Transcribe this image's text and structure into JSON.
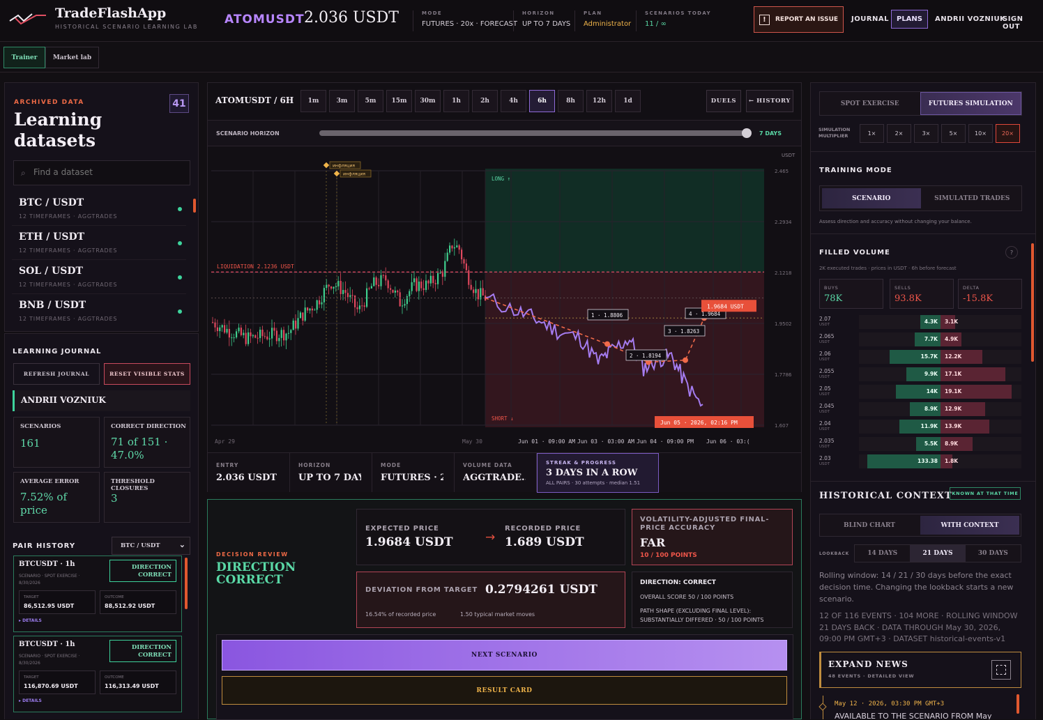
{
  "header": {
    "app_name": "TradeFlashApp",
    "app_subtitle": "HISTORICAL SCENARIO LEARNING LAB",
    "symbol": "ATOMUSDT",
    "price": "2.036 USDT",
    "metrics": [
      {
        "key": "MODE",
        "value": "FUTURES · 20x · FORECAST"
      },
      {
        "key": "HORIZON",
        "value": "UP TO 7 DAYS"
      },
      {
        "key": "PLAN",
        "value": "Administrator"
      },
      {
        "key": "SCENARIOS TODAY",
        "value": "11 / ∞"
      }
    ],
    "report_label": "REPORT AN ISSUE",
    "nav": {
      "journal": "JOURNAL",
      "plans": "PLANS",
      "user": "ANDRII VOZNIUK",
      "signout": "SIGN OUT"
    }
  },
  "subtabs": {
    "trainer": "Trainer",
    "market_lab": "Market lab"
  },
  "datasets": {
    "kicker": "ARCHIVED DATA",
    "title_line1": "Learning",
    "title_line2": "datasets",
    "count": "41",
    "search_placeholder": "Find a dataset",
    "items": [
      {
        "name": "BTC / USDT",
        "sub": "12 TIMEFRAMES · AGGTRADES"
      },
      {
        "name": "ETH / USDT",
        "sub": "12 TIMEFRAMES · AGGTRADES"
      },
      {
        "name": "SOL / USDT",
        "sub": "12 TIMEFRAMES · AGGTRADES"
      },
      {
        "name": "BNB / USDT",
        "sub": "12 TIMEFRAMES · AGGTRADES"
      }
    ]
  },
  "journal": {
    "title": "LEARNING JOURNAL",
    "refresh": "REFRESH JOURNAL",
    "reset": "RESET VISIBLE STATS",
    "user": "ANDRII VOZNIUK",
    "stats": [
      {
        "key": "SCENARIOS",
        "value": "161"
      },
      {
        "key": "CORRECT DIRECTION",
        "value": "71 of 151 · 47.0%"
      },
      {
        "key": "AVERAGE ERROR",
        "value": "7.52% of price"
      },
      {
        "key": "THRESHOLD CLOSURES",
        "value": "3"
      }
    ]
  },
  "pair_history": {
    "title": "PAIR HISTORY",
    "select": "BTC / USDT",
    "items": [
      {
        "title": "BTCUSDT · 1h",
        "sub": "SCENARIO · SPOT EXERCISE · 8/30/2026",
        "badge": "DIRECTION CORRECT",
        "target_label": "TARGET",
        "target": "86,512.95 USDT",
        "outcome_label": "OUTCOME",
        "outcome": "88,512.92 USDT",
        "details": "▸ DETAILS"
      },
      {
        "title": "BTCUSDT · 1h",
        "sub": "SCENARIO · SPOT EXERCISE · 8/30/2026",
        "badge": "DIRECTION CORRECT",
        "target_label": "TARGET",
        "target": "116,870.69 USDT",
        "outcome_label": "OUTCOME",
        "outcome": "116,313.49 USDT",
        "details": "▸ DETAILS"
      }
    ]
  },
  "chart_panel": {
    "title": "ATOMUSDT / 6H",
    "timeframes": [
      "1m",
      "3m",
      "5m",
      "15m",
      "30m",
      "1h",
      "2h",
      "4h",
      "6h",
      "8h",
      "12h",
      "1d"
    ],
    "active_tf": "6h",
    "duels": "DUELS",
    "history": "← HISTORY",
    "horizon_label": "SCENARIO HORIZON",
    "horizon_value": "7 DAYS",
    "info": [
      {
        "key": "ENTRY",
        "value": "2.036 USDT"
      },
      {
        "key": "HORIZON",
        "value": "UP TO 7 DAYS"
      },
      {
        "key": "MODE",
        "value": "FUTURES · 2..."
      },
      {
        "key": "VOLUME DATA",
        "value": "AGGTRADE..."
      }
    ],
    "streak": {
      "key": "STREAK & PROGRESS",
      "value": "3 DAYS IN A ROW",
      "sub": "ALL PAIRS · 30 attempts · median 1.51"
    }
  },
  "chart_data": {
    "type": "candlestick",
    "unit_label": "USDT",
    "y_ticks": [
      "2.465",
      "2.2934",
      "2.1218",
      "1.9502",
      "1.7786",
      "1.607"
    ],
    "ylim": [
      1.607,
      2.465
    ],
    "x_ticks": [
      "Apr 29",
      "May 30",
      "Jun 01 · 09:00 AM",
      "Jun 03 · 03:00 AM",
      "Jun 04 · 09:00 PM",
      "Jun 06 · 03:("
    ],
    "liquidation_label": "LIQUIDATION 2.1236 USDT",
    "liquidation": 2.1236,
    "long_label": "LONG ↑",
    "short_label": "SHORT ↓",
    "event_markers": [
      "инфляция",
      "инфляция"
    ],
    "forecast_points": [
      {
        "label": "1 · 1.8806",
        "value": 1.8806
      },
      {
        "label": "2 · 1.8194",
        "value": 1.8194
      },
      {
        "label": "3 · 1.8263",
        "value": 1.8263
      },
      {
        "label": "4 · 1.9684",
        "value": 1.9684
      }
    ],
    "target_label": "1.9684 USDT",
    "target_value": 1.9684,
    "end_label": "Jun 05 · 2026, 02:16 PM"
  },
  "decision": {
    "kicker": "DECISION REVIEW",
    "title_line1": "DIRECTION",
    "title_line2": "CORRECT",
    "expected_label": "EXPECTED PRICE",
    "expected": "1.9684 USDT",
    "recorded_label": "RECORDED PRICE",
    "recorded": "1.689 USDT",
    "vol_label": "VOLATILITY-ADJUSTED FINAL-PRICE ACCURACY",
    "vol_value": "FAR",
    "vol_points": "10 / 100 POINTS",
    "deviation_label": "DEVIATION FROM TARGET",
    "deviation": "0.2794261 USDT",
    "deviation_pct": "16.54% of recorded price",
    "deviation_moves": "1.50 typical market moves",
    "summary_title": "DIRECTION: CORRECT",
    "summary_line1": "OVERALL SCORE 50 / 100 POINTS",
    "summary_line2": "PATH SHAPE (EXCLUDING FINAL LEVEL): SUBSTANTIALLY DIFFERED · 50 / 100 POINTS",
    "next": "NEXT SCENARIO",
    "result": "RESULT CARD"
  },
  "right": {
    "mode_tabs": [
      "SPOT EXERCISE",
      "FUTURES SIMULATION"
    ],
    "sim_label": "SIMULATION MULTIPLIER",
    "multipliers": [
      "1×",
      "2×",
      "3×",
      "5×",
      "10×",
      "20×"
    ],
    "training_title": "TRAINING MODE",
    "training_tabs": [
      "SCENARIO",
      "SIMULATED TRADES"
    ],
    "training_note": "Assess direction and accuracy without changing your balance.",
    "filled_title": "FILLED VOLUME",
    "filled_sub": "2K executed trades · prices in USDT · 6h before forecast",
    "buys_label": "BUYS",
    "buys": "78K",
    "sells_label": "SELLS",
    "sells": "93.8K",
    "delta_label": "DELTA",
    "delta": "-15.8K",
    "orderbook": [
      {
        "price": "2.07",
        "buy": "4.3K",
        "sell": "3.1K",
        "bf": 0.25,
        "sf": 0.18
      },
      {
        "price": "2.065",
        "buy": "7.7K",
        "sell": "4.9K",
        "bf": 0.32,
        "sf": 0.26
      },
      {
        "price": "2.06",
        "buy": "15.7K",
        "sell": "12.2K",
        "bf": 0.62,
        "sf": 0.52
      },
      {
        "price": "2.055",
        "buy": "9.9K",
        "sell": "17.1K",
        "bf": 0.42,
        "sf": 0.8
      },
      {
        "price": "2.05",
        "buy": "14K",
        "sell": "19.1K",
        "bf": 0.55,
        "sf": 0.88
      },
      {
        "price": "2.045",
        "buy": "8.9K",
        "sell": "12.9K",
        "bf": 0.38,
        "sf": 0.55
      },
      {
        "price": "2.04",
        "buy": "11.9K",
        "sell": "13.9K",
        "bf": 0.5,
        "sf": 0.6
      },
      {
        "price": "2.035",
        "buy": "5.5K",
        "sell": "8.9K",
        "bf": 0.3,
        "sf": 0.4
      },
      {
        "price": "2.03",
        "buy": "133.38",
        "sell": "1.8K",
        "bf": 0.9,
        "sf": 0.15
      }
    ],
    "ob_unit": "USDT",
    "context_title": "HISTORICAL CONTEXT",
    "context_badge": "KNOWN AT THAT TIME",
    "context_tabs": [
      "BLIND CHART",
      "WITH CONTEXT"
    ],
    "lookback_label": "LOOKBACK",
    "lookback": [
      "14 DAYS",
      "21 DAYS",
      "30 DAYS"
    ],
    "context_text": "Rolling window: 14 / 21 / 30 days before the exact decision time. Changing the lookback starts a new scenario.",
    "context_meta": "12 OF 116 EVENTS · 104 MORE · ROLLING WINDOW 21 DAYS BACK · DATA THROUGH May 30, 2026, 09:00 PM GMT+3 · DATASET historical-events-v1",
    "expand_title": "EXPAND NEWS",
    "expand_sub": "48 EVENTS · DETAILED VIEW",
    "news_date": "May 12 · 2026, 03:30 PM GMT+3",
    "news_text": "AVAILABLE TO THE SCENARIO FROM May"
  }
}
